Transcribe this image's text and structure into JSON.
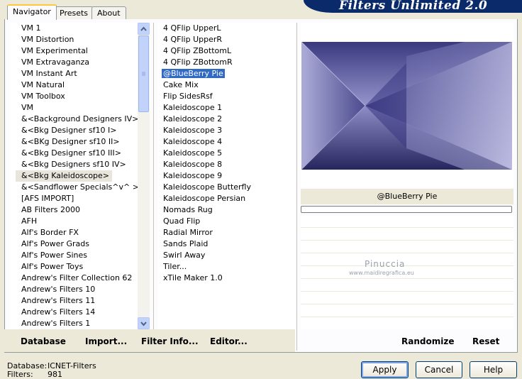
{
  "app": {
    "title": "Filters Unlimited 2.0"
  },
  "tabs": [
    {
      "label": "Navigator"
    },
    {
      "label": "Presets"
    },
    {
      "label": "About"
    }
  ],
  "categories": [
    "VM 1",
    "VM Distortion",
    "VM Experimental",
    "VM Extravaganza",
    "VM Instant Art",
    "VM Natural",
    "VM Toolbox",
    "VM",
    "&<Background Designers IV>",
    "&<Bkg Designer sf10 I>",
    "&<BKg Designer sf10 II>",
    "&<Bkg Designer sf10 III>",
    "&<Bkg Designers sf10 IV>",
    "&<Bkg Kaleidoscope>",
    "&<Sandflower Specials^v^ >",
    "[AFS IMPORT]",
    "AB Filters 2000",
    "AFH",
    "Alf's Border FX",
    "Alf's Power Grads",
    "Alf's Power Sines",
    "Alf's Power Toys",
    "Andrew's Filter Collection 62",
    "Andrew's Filters 10",
    "Andrew's Filters 11",
    "Andrew's Filters 14",
    "Andrew's Filters 1"
  ],
  "selected_category_index": 13,
  "filters": [
    "4 QFlip UpperL",
    "4 QFlip UpperR",
    "4 QFlip ZBottomL",
    "4 QFlip ZBottomR",
    "@BlueBerry Pie",
    "Cake Mix",
    "Flip SidesRsf",
    "Kaleidoscope 1",
    "Kaleidoscope 2",
    "Kaleidoscope 3",
    "Kaleidoscope 4",
    "Kaleidoscope 5",
    "Kaleidoscope 8",
    "Kaleidoscope 9",
    "Kaleidoscope Butterfly",
    "Kaleidoscope Persian",
    "Nomads Rug",
    "Quad Flip",
    "Radial Mirror",
    "Sands Plaid",
    "Swirl Away",
    "Tiler...",
    "xTile Maker 1.0"
  ],
  "selected_filter_index": 4,
  "preview": {
    "filter_name": "@BlueBerry Pie"
  },
  "watermark": {
    "name": "Pinuccia",
    "url": "www.maidiregrafica.eu"
  },
  "toolbar": {
    "database": "Database",
    "import": "Import...",
    "filter_info": "Filter Info...",
    "editor": "Editor...",
    "randomize": "Randomize",
    "reset": "Reset"
  },
  "status": {
    "database_label": "Database:",
    "database_value": "ICNET-Filters",
    "filters_label": "Filters:",
    "filters_value": "981"
  },
  "buttons": {
    "apply": "Apply",
    "cancel": "Cancel",
    "help": "Help"
  },
  "icons": {
    "scroll_up": "chevron-up-icon",
    "scroll_down": "chevron-down-icon"
  },
  "colors": {
    "title_banner": "#0a2a6a",
    "selection": "#316ac5",
    "preview_dark": "#2e2d6e",
    "preview_light": "#a9a8d6"
  }
}
